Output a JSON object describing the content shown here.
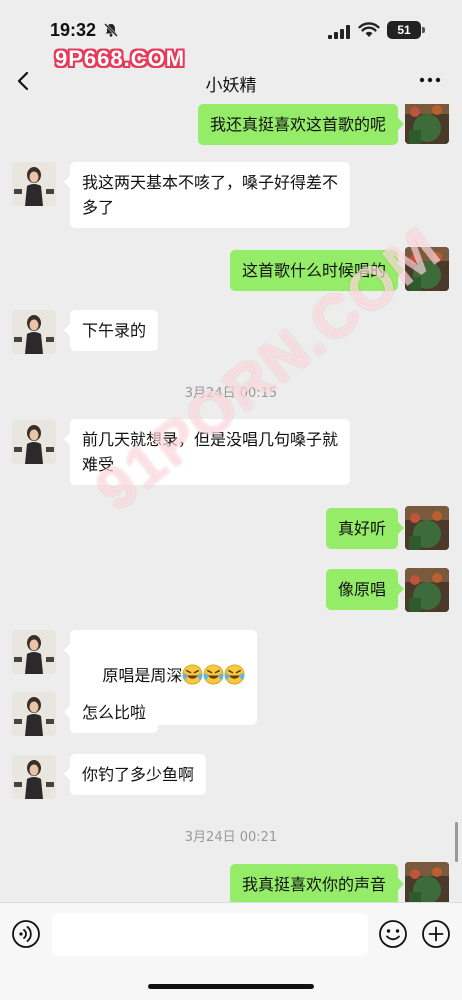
{
  "status_bar": {
    "time": "19:32",
    "battery": "51",
    "icons": [
      "bell-muted-icon",
      "signal-icon",
      "wifi-icon",
      "battery-icon"
    ]
  },
  "watermark": {
    "top": "9P668.COM",
    "diagonal": "91PORN.COM"
  },
  "nav": {
    "title": "小妖精",
    "back_icon": "back-icon",
    "more_icon": "more-icon"
  },
  "messages": [
    {
      "side": "right",
      "text": "我还真挺喜欢这首歌的呢"
    },
    {
      "side": "left",
      "text": "我这两天基本不咳了，嗓子好得差不\n多了"
    },
    {
      "side": "right",
      "text": "这首歌什么时候唱的"
    },
    {
      "side": "left",
      "text": "下午录的"
    },
    {
      "type": "time",
      "text": "3月24日 00:15"
    },
    {
      "side": "left",
      "text": "前几天就想录，但是没唱几句嗓子就\n难受"
    },
    {
      "side": "right",
      "text": "真好听"
    },
    {
      "side": "right",
      "text": "像原唱"
    },
    {
      "side": "left",
      "text": "原唱是周深",
      "emoji": "crying-laughing-emoji-icon"
    },
    {
      "side": "left",
      "text": "怎么比啦"
    },
    {
      "side": "left",
      "text": "你钓了多少鱼啊"
    },
    {
      "type": "time",
      "text": "3月24日 00:21"
    },
    {
      "side": "right",
      "text": "我真挺喜欢你的声音"
    }
  ],
  "input_bar": {
    "voice_icon": "voice-icon",
    "emoji_icon": "emoji-icon",
    "plus_icon": "plus-icon",
    "input_value": ""
  },
  "colors": {
    "background": "#ededed",
    "sent_bubble": "#95ec69",
    "received_bubble": "#ffffff",
    "watermark": "#e63a5a"
  }
}
